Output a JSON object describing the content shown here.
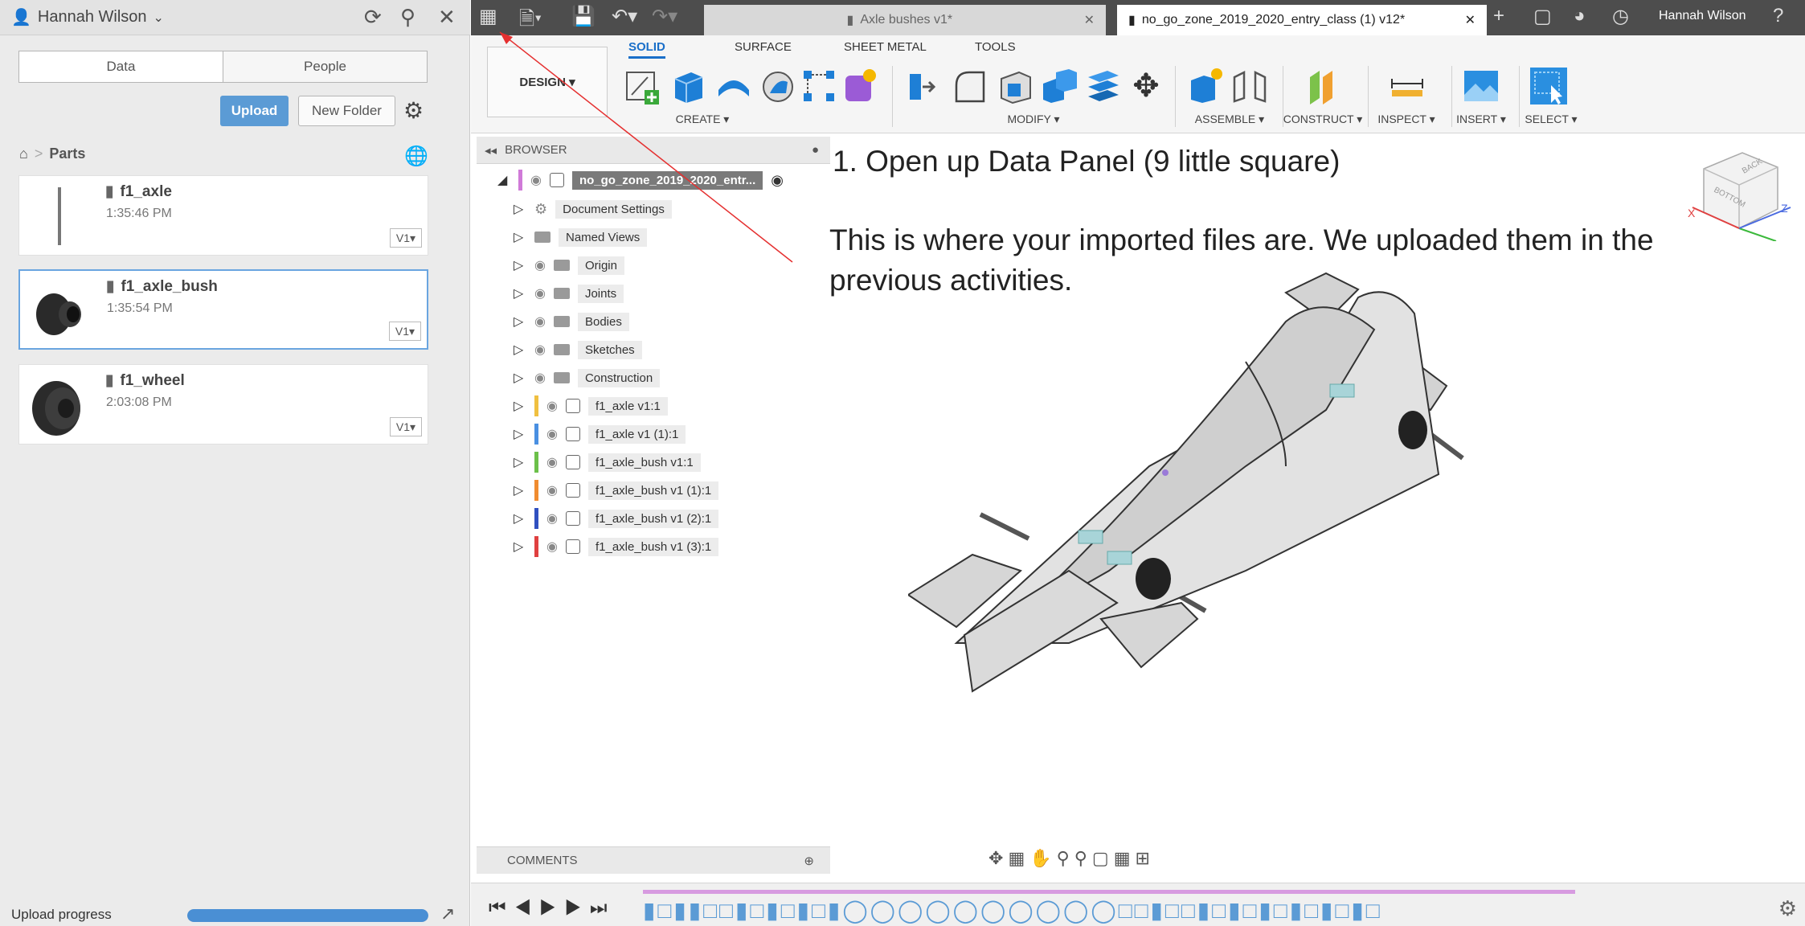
{
  "data_panel": {
    "user_name": "Hannah Wilson",
    "tabs": [
      "Data",
      "People"
    ],
    "upload_label": "Upload",
    "new_folder_label": "New Folder",
    "breadcrumb": "Parts",
    "files": [
      {
        "name": "f1_axle",
        "time": "1:35:46 PM",
        "version": "V1"
      },
      {
        "name": "f1_axle_bush",
        "time": "1:35:54 PM",
        "version": "V1"
      },
      {
        "name": "f1_wheel",
        "time": "2:03:08 PM",
        "version": "V1"
      }
    ],
    "upload_progress_label": "Upload progress",
    "upload_progress": 1.0
  },
  "topbar": {
    "tabs": [
      {
        "label": "Axle bushes v1*",
        "active": false
      },
      {
        "label": "no_go_zone_2019_2020_entry_class (1) v12*",
        "active": true
      }
    ],
    "user_name": "Hannah Wilson"
  },
  "toolbar": {
    "workspace": "DESIGN",
    "tabs": [
      "SOLID",
      "SURFACE",
      "SHEET METAL",
      "TOOLS"
    ],
    "groups": [
      "CREATE",
      "MODIFY",
      "ASSEMBLE",
      "CONSTRUCT",
      "INSPECT",
      "INSERT",
      "SELECT"
    ]
  },
  "browser": {
    "title": "BROWSER",
    "root": "no_go_zone_2019_2020_entr...",
    "items": [
      {
        "label": "Document Settings",
        "kind": "settings",
        "color": ""
      },
      {
        "label": "Named Views",
        "kind": "folder",
        "color": ""
      },
      {
        "label": "Origin",
        "kind": "folder",
        "color": ""
      },
      {
        "label": "Joints",
        "kind": "folder",
        "color": ""
      },
      {
        "label": "Bodies",
        "kind": "folder",
        "color": ""
      },
      {
        "label": "Sketches",
        "kind": "folder",
        "color": ""
      },
      {
        "label": "Construction",
        "kind": "folder",
        "color": ""
      },
      {
        "label": "f1_axle v1:1",
        "kind": "component",
        "color": "#f0c040"
      },
      {
        "label": "f1_axle v1 (1):1",
        "kind": "component",
        "color": "#4a90e2"
      },
      {
        "label": "f1_axle_bush v1:1",
        "kind": "component",
        "color": "#6cc04a"
      },
      {
        "label": "f1_axle_bush v1 (1):1",
        "kind": "component",
        "color": "#f08c30"
      },
      {
        "label": "f1_axle_bush v1 (2):1",
        "kind": "component",
        "color": "#3050c0"
      },
      {
        "label": "f1_axle_bush v1 (3):1",
        "kind": "component",
        "color": "#e04040"
      }
    ]
  },
  "annotation": {
    "step": "1.  Open up Data Panel (9 little square)",
    "body": "This is where your imported files are. We uploaded them in the previous activities."
  },
  "viewcube": {
    "front": "BOTTOM",
    "top": "BACK"
  },
  "comments_label": "COMMENTS"
}
